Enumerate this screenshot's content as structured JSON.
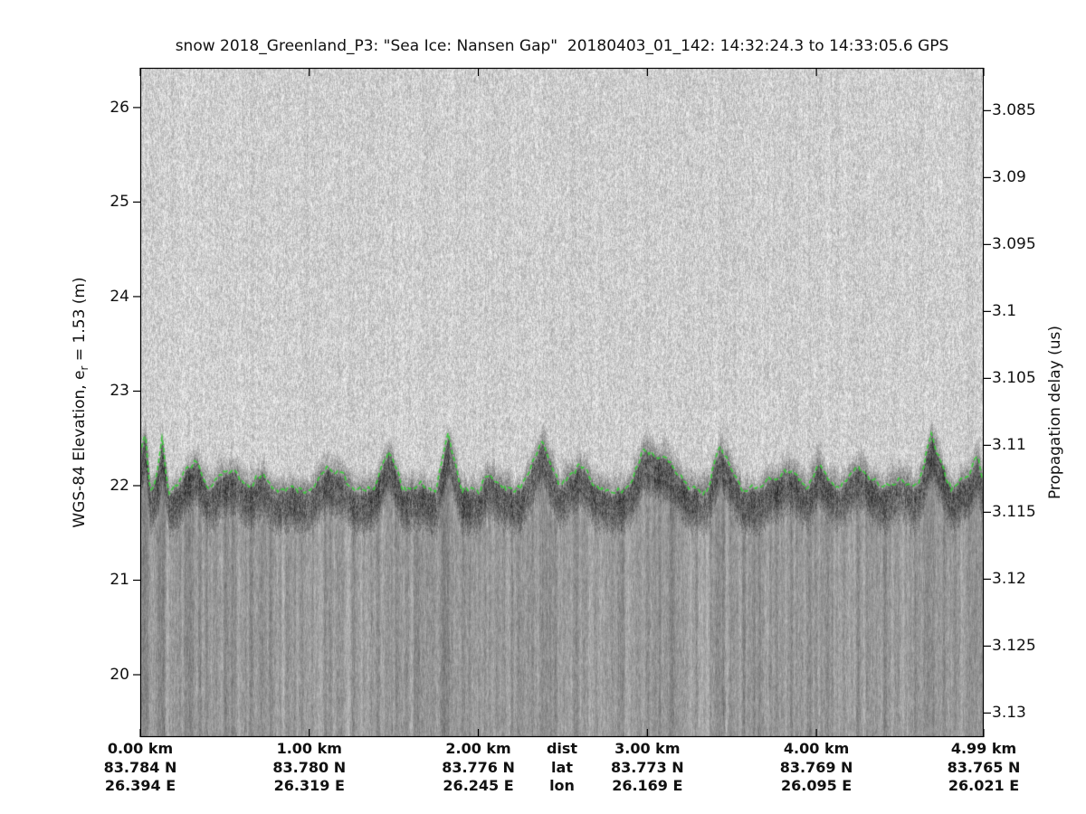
{
  "title": "snow 2018_Greenland_P3: \"Sea Ice: Nansen Gap\"  20180403_01_142: 14:32:24.3 to 14:33:05.6 GPS",
  "axes": {
    "left": {
      "label_prefix": "WGS-84 Elevation, e",
      "label_sub": "r",
      "label_suffix": " = 1.53 (m)",
      "tick_values": [
        26,
        25,
        24,
        23,
        22,
        21,
        20
      ],
      "range": [
        19.34,
        26.42
      ]
    },
    "right": {
      "label": "Propagation delay (us)",
      "tick_labels": [
        "3.085",
        "3.09",
        "3.095",
        "3.1",
        "3.105",
        "3.11",
        "3.115",
        "3.12",
        "3.125",
        "3.13"
      ],
      "tick_values": [
        3.085,
        3.09,
        3.095,
        3.1,
        3.105,
        3.11,
        3.115,
        3.12,
        3.125,
        3.13
      ],
      "range": [
        3.0818,
        3.1318
      ]
    },
    "bottom": {
      "row_headers": [
        "dist",
        "lat",
        "lon"
      ],
      "columns": [
        {
          "km": 0.0,
          "dist": "0.00 km",
          "lat": "83.784 N",
          "lon": "26.394 E"
        },
        {
          "km": 1.0,
          "dist": "1.00 km",
          "lat": "83.780 N",
          "lon": "26.319 E"
        },
        {
          "km": 2.0,
          "dist": "2.00 km",
          "lat": "83.776 N",
          "lon": "26.245 E"
        },
        {
          "km": 3.0,
          "dist": "3.00 km",
          "lat": "83.773 N",
          "lon": "26.169 E"
        },
        {
          "km": 4.0,
          "dist": "4.00 km",
          "lat": "83.769 N",
          "lon": "26.095 E"
        },
        {
          "km": 4.99,
          "dist": "4.99 km",
          "lat": "83.765 N",
          "lon": "26.021 E"
        }
      ],
      "range_km": [
        0,
        4.99
      ]
    }
  },
  "chart_data": {
    "type": "heatmap",
    "description": "Airborne snow radar echogram of sea ice: grayscale backscatter intensity vs distance and WGS-84 elevation, with a green dashed surface pick tracking the ice surface near 22 m elevation; bright speckle above the surface, dark surface return band, and vertically streaked gray water/ice column below.",
    "title": "snow 2018_Greenland_P3: \"Sea Ice: Nansen Gap\"  20180403_01_142: 14:32:24.3 to 14:33:05.6 GPS",
    "x_axis": {
      "name": "distance",
      "units": "km",
      "range": [
        0,
        4.99
      ],
      "ticks_km": [
        0.0,
        1.0,
        2.0,
        3.0,
        4.0,
        4.99
      ]
    },
    "y_axis_left": {
      "name": "WGS-84 Elevation",
      "units": "m",
      "relative_permittivity": "1.53",
      "range": [
        19.34,
        26.42
      ],
      "ticks": [
        20,
        21,
        22,
        23,
        24,
        25,
        26
      ]
    },
    "y_axis_right": {
      "name": "Propagation delay",
      "units": "us",
      "range": [
        3.0818,
        3.1318
      ],
      "ticks": [
        3.085,
        3.09,
        3.095,
        3.1,
        3.105,
        3.11,
        3.115,
        3.12,
        3.125,
        3.13
      ]
    },
    "legend": "none",
    "grid": false,
    "surface_pick": {
      "name": "surface pick (green dashed trace)",
      "color": "#3cc83c",
      "x_km": [
        0.0,
        0.03,
        0.06,
        0.1,
        0.13,
        0.17,
        0.22,
        0.28,
        0.34,
        0.4,
        0.48,
        0.56,
        0.64,
        0.72,
        0.8,
        0.9,
        1.0,
        1.1,
        1.18,
        1.28,
        1.38,
        1.47,
        1.55,
        1.65,
        1.75,
        1.82,
        1.9,
        2.0,
        2.06,
        2.15,
        2.25,
        2.38,
        2.48,
        2.6,
        2.7,
        2.8,
        2.9,
        2.98,
        3.12,
        3.25,
        3.35,
        3.43,
        3.55,
        3.65,
        3.75,
        3.85,
        3.95,
        4.01,
        4.12,
        4.25,
        4.38,
        4.5,
        4.6,
        4.68,
        4.8,
        4.9,
        4.95,
        4.99
      ],
      "elevation_m": [
        22.3,
        22.52,
        21.9,
        22.1,
        22.45,
        21.88,
        21.95,
        22.18,
        22.22,
        21.92,
        22.08,
        22.12,
        21.95,
        22.1,
        21.9,
        21.96,
        21.92,
        22.15,
        22.1,
        21.9,
        21.95,
        22.35,
        21.92,
        21.98,
        21.9,
        22.5,
        21.95,
        21.9,
        22.12,
        21.95,
        21.92,
        22.45,
        21.95,
        22.2,
        21.95,
        21.9,
        22.0,
        22.35,
        22.25,
        21.95,
        21.9,
        22.4,
        21.95,
        21.92,
        22.05,
        22.15,
        21.95,
        22.2,
        21.95,
        22.18,
        21.95,
        22.05,
        21.95,
        22.5,
        21.92,
        22.1,
        22.3,
        22.0
      ]
    },
    "colors": {
      "above_surface_gray": "#cdcdcd",
      "surface_band_gray": "#4a4a4a",
      "below_surface_gray": "#999999",
      "axis_color": "#000000",
      "figure_background": "#ffffff",
      "text_color": "#111111"
    }
  }
}
